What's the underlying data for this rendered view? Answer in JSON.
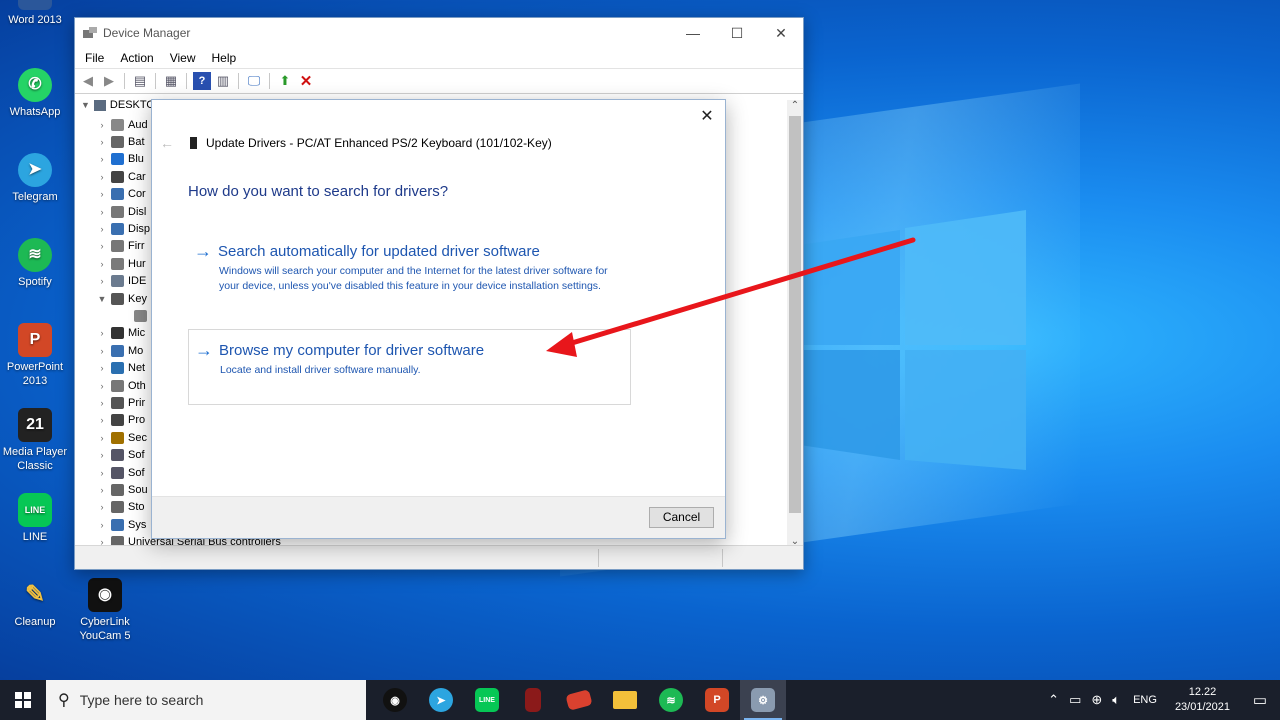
{
  "desktop": {
    "icons": [
      {
        "label": "Word 2013",
        "icon": "word-icon"
      },
      {
        "label": "WhatsApp",
        "icon": "whatsapp-icon"
      },
      {
        "label": "Telegram",
        "icon": "telegram-icon"
      },
      {
        "label": "Spotify",
        "icon": "spotify-icon"
      },
      {
        "label": "PowerPoint 2013",
        "icon": "powerpoint-icon"
      },
      {
        "label": "Media Player Classic",
        "icon": "media-player-icon"
      },
      {
        "label": "LINE",
        "icon": "line-icon"
      },
      {
        "label": "Cleanup",
        "icon": "cleanup-icon"
      },
      {
        "label": "CyberLink YouCam 5",
        "icon": "youcam-icon"
      }
    ]
  },
  "device_manager": {
    "title": "Device Manager",
    "menu": [
      "File",
      "Action",
      "View",
      "Help"
    ],
    "tree_root": "DESKTO",
    "tree_items": [
      {
        "label": "Aud",
        "expanded": false
      },
      {
        "label": "Bat",
        "expanded": false
      },
      {
        "label": "Blu",
        "expanded": false
      },
      {
        "label": "Car",
        "expanded": false
      },
      {
        "label": "Cor",
        "expanded": false
      },
      {
        "label": "Disl",
        "expanded": false
      },
      {
        "label": "Disp",
        "expanded": false
      },
      {
        "label": "Firr",
        "expanded": false
      },
      {
        "label": "Hur",
        "expanded": false
      },
      {
        "label": "IDE",
        "expanded": false
      },
      {
        "label": "Key",
        "expanded": true
      },
      {
        "label": "",
        "expanded": false,
        "child": true
      },
      {
        "label": "Mic",
        "expanded": false
      },
      {
        "label": "Mo",
        "expanded": false
      },
      {
        "label": "Net",
        "expanded": false
      },
      {
        "label": "Oth",
        "expanded": false
      },
      {
        "label": "Prir",
        "expanded": false
      },
      {
        "label": "Pro",
        "expanded": false
      },
      {
        "label": "Sec",
        "expanded": false
      },
      {
        "label": "Sof",
        "expanded": false
      },
      {
        "label": "Sof",
        "expanded": false
      },
      {
        "label": "Sou",
        "expanded": false
      },
      {
        "label": "Sto",
        "expanded": false
      },
      {
        "label": "Sys",
        "expanded": false
      },
      {
        "label": "Universal Serial Bus controllers",
        "expanded": false
      }
    ]
  },
  "update_dialog": {
    "header": "Update Drivers - PC/AT Enhanced PS/2 Keyboard (101/102-Key)",
    "question": "How do you want to search for drivers?",
    "option_auto": {
      "title": "Search automatically for updated driver software",
      "desc": "Windows will search your computer and the Internet for the latest driver software for your device, unless you've disabled this feature in your device installation settings."
    },
    "option_browse": {
      "title": "Browse my computer for driver software",
      "desc": "Locate and install driver software manually."
    },
    "cancel_label": "Cancel"
  },
  "taskbar": {
    "search_placeholder": "Type here to search",
    "apps": [
      "youcam",
      "telegram",
      "line",
      "book",
      "red-app",
      "file-explorer",
      "spotify",
      "powerpoint",
      "device-manager"
    ],
    "language": "ENG",
    "time": "12.22",
    "date": "23/01/2021"
  },
  "colors": {
    "link_blue": "#1e56b0",
    "annotation_red": "#e8161b",
    "taskbar_bg": "#1a1f2b"
  }
}
